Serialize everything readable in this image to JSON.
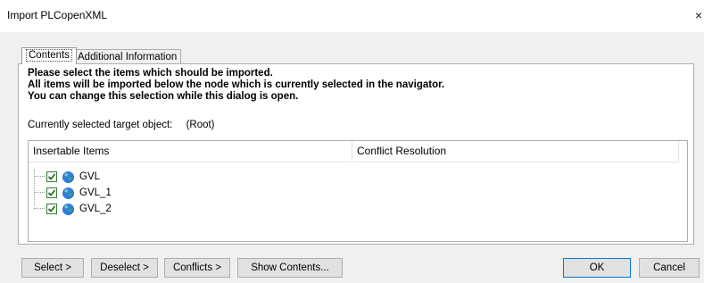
{
  "window": {
    "title": "Import PLCopenXML",
    "close_glyph": "×"
  },
  "tabs": [
    {
      "label": "Contents",
      "selected": true
    },
    {
      "label": "Additional Information",
      "selected": false
    }
  ],
  "instructions": {
    "line1": "Please select the items which should be imported.",
    "line2": "All items will be imported below the node which is currently selected in the navigator.",
    "line3": "You can change this selection while this dialog is open."
  },
  "target": {
    "label": "Currently selected target object:",
    "value": "(Root)"
  },
  "table": {
    "columns": [
      "Insertable Items",
      "Conflict Resolution"
    ],
    "items": [
      {
        "label": "GVL",
        "checked": true,
        "icon": "globe-icon"
      },
      {
        "label": "GVL_1",
        "checked": true,
        "icon": "globe-icon"
      },
      {
        "label": "GVL_2",
        "checked": true,
        "icon": "globe-icon"
      }
    ]
  },
  "buttons": {
    "select": "Select >",
    "deselect": "Deselect >",
    "conflicts": "Conflicts >",
    "show_contents": "Show Contents...",
    "ok": "OK",
    "cancel": "Cancel"
  },
  "colors": {
    "dialog_bg": "#f0f0f0",
    "button_bg": "#e1e1e1",
    "default_button_border": "#0078d7",
    "checkbox_border": "#2e7d32"
  }
}
